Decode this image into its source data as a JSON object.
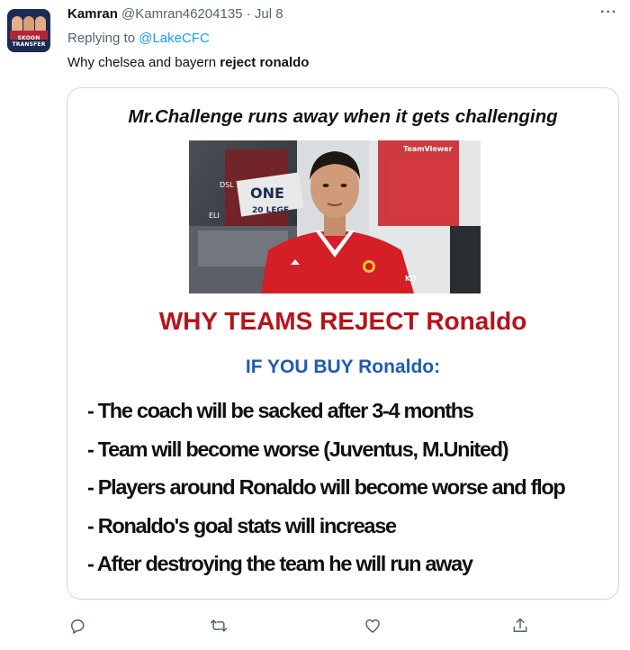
{
  "author": {
    "name": "Kamran",
    "handle": "@Kamran46204135",
    "separator": "·",
    "date": "Jul 8",
    "avatar_label": "SKOON TRANSFER",
    "avatar_icon": "avatar"
  },
  "reply": {
    "prefix": "Replying to ",
    "mention": "@LakeCFC"
  },
  "tweet": {
    "text_plain": "Why chelsea and bayern ",
    "text_bold": "reject ronaldo"
  },
  "media": {
    "title": "Mr.Challenge runs away when it gets challenging",
    "photo_texts": {
      "banner1": "ONE",
      "banner2": "20 LEGE",
      "sponsor": "TeamViewer",
      "small1": "DSL",
      "small2": "ELI",
      "shirt_brand": "KO"
    },
    "heading": "WHY TEAMS REJECT Ronaldo",
    "subheading": "IF YOU BUY Ronaldo:",
    "points": [
      "- The coach will be sacked after 3-4 months",
      "- Team will become worse (Juventus, M.United)",
      "- Players around Ronaldo will become worse and flop",
      "- Ronaldo's goal stats will increase",
      "- After destroying the team he will run away"
    ],
    "colors": {
      "heading": "#b4141b",
      "subheading": "#1f5bb0",
      "shirt": "#d41f26"
    }
  },
  "actions": {
    "reply_icon": "reply-icon",
    "retweet_icon": "retweet-icon",
    "like_icon": "like-icon",
    "share_icon": "share-icon"
  },
  "ui": {
    "more_label": "···",
    "accent": "#1d9bf0",
    "muted": "#536471"
  }
}
